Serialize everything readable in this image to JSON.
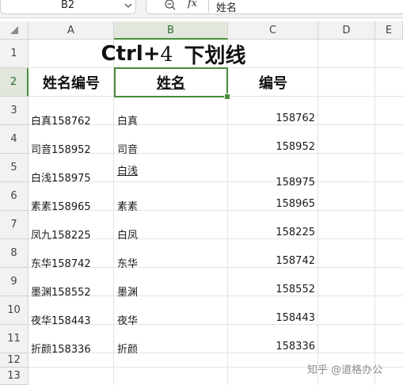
{
  "formula_bar": {
    "name_box": "B2",
    "formula_value": "姓名",
    "fx_label": "fx"
  },
  "icons": {
    "name_box_dropdown": "chevron-down-icon",
    "zoom": "zoom-out-icon",
    "select_all": "select-all-triangle-icon"
  },
  "columns": [
    "A",
    "B",
    "C",
    "D",
    "E"
  ],
  "rows": [
    "1",
    "2",
    "3",
    "4",
    "5",
    "6",
    "7",
    "8",
    "9",
    "10",
    "11",
    "12",
    "13"
  ],
  "sheet": {
    "title": {
      "keys": "Ctrl+",
      "digit": "4",
      "action": "下划线"
    },
    "headers": [
      "姓名编号",
      "姓名",
      "编号"
    ],
    "records": [
      {
        "id_name": "白真158762",
        "name": "白真",
        "number": "158762"
      },
      {
        "id_name": "司音158952",
        "name": "司音",
        "number": "158952"
      },
      {
        "id_name": "白浅158975",
        "name": "白浅",
        "number": "158975"
      },
      {
        "id_name": "素素158965",
        "name": "素素",
        "number": "158965"
      },
      {
        "id_name": "凤九158225",
        "name": "白凤",
        "number": "158225"
      },
      {
        "id_name": "东华158742",
        "name": "东华",
        "number": "158742"
      },
      {
        "id_name": "墨渊158552",
        "name": "墨渊",
        "number": "158552"
      },
      {
        "id_name": "夜华158443",
        "name": "夜华",
        "number": "158443"
      },
      {
        "id_name": "折颜158336",
        "name": "折颜",
        "number": "158336"
      }
    ]
  },
  "selected_cell": {
    "column": "B",
    "row": "2"
  },
  "colors": {
    "selection": "#4a8a3a",
    "header_bg": "#f2f2f2",
    "grid_line": "#e3e3e3"
  },
  "watermark": "知乎 @道格办公"
}
